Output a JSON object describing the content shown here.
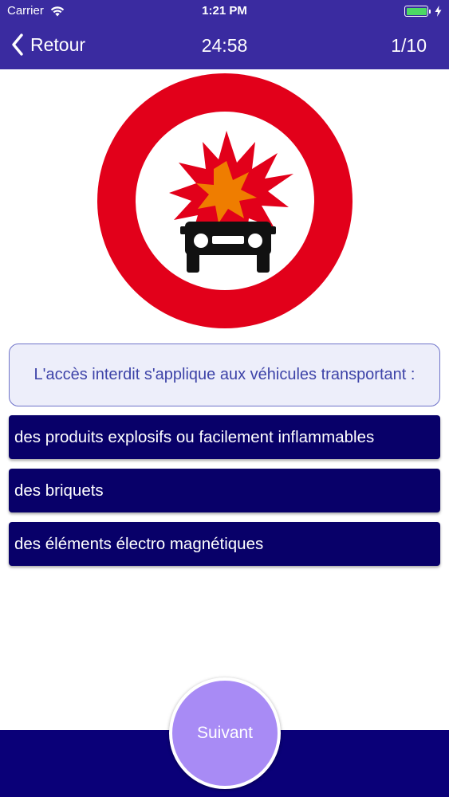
{
  "status_bar": {
    "carrier": "Carrier",
    "time": "1:21 PM"
  },
  "nav": {
    "back_label": "Retour",
    "timer": "24:58",
    "progress": "1/10"
  },
  "question": {
    "text": "L'accès interdit s'applique aux véhicules transportant :"
  },
  "answers": [
    {
      "label": "des produits explosifs ou facilement inflammables"
    },
    {
      "label": "des briquets"
    },
    {
      "label": "des éléments électro magnétiques"
    }
  ],
  "next_button": {
    "label": "Suivant"
  },
  "colors": {
    "header": "#3a2ba0",
    "answer_bg": "#080069",
    "next_button": "#a88bf5",
    "bottom_bar": "#0a0078",
    "sign_ring": "#e2001a",
    "battery": "#4cd964"
  },
  "icons": {
    "back": "chevron-left-icon",
    "wifi": "wifi-icon",
    "battery": "battery-icon",
    "charging": "bolt-icon",
    "sign": "no-explosives-sign-icon"
  }
}
